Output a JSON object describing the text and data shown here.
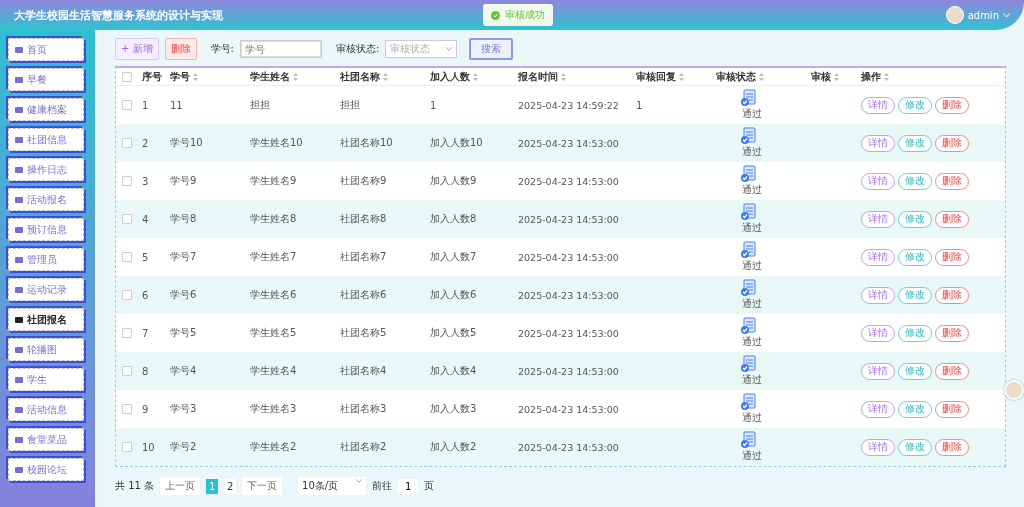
{
  "header": {
    "title": "大学生校园生活智慧服务系统的设计与实现",
    "toast": "审核成功",
    "user": "admin"
  },
  "sidebar": {
    "items": [
      {
        "label": "首页",
        "selected": false
      },
      {
        "label": "早餐",
        "selected": false
      },
      {
        "label": "健康档案",
        "selected": false
      },
      {
        "label": "社团信息",
        "selected": false
      },
      {
        "label": "操作日志",
        "selected": false
      },
      {
        "label": "活动报名",
        "selected": false
      },
      {
        "label": "预订信息",
        "selected": false
      },
      {
        "label": "管理员",
        "selected": false
      },
      {
        "label": "运动记录",
        "selected": false
      },
      {
        "label": "社团报名",
        "selected": true
      },
      {
        "label": "轮播图",
        "selected": false
      },
      {
        "label": "学生",
        "selected": false
      },
      {
        "label": "活动信息",
        "selected": false
      },
      {
        "label": "食堂菜品",
        "selected": false
      },
      {
        "label": "校园论坛",
        "selected": false
      }
    ]
  },
  "toolbar": {
    "add_button": "+ 新增",
    "delete_button": "删除",
    "student_id_label": "学号:",
    "student_id_placeholder": "学号",
    "status_label": "审核状态:",
    "status_placeholder": "审核状态",
    "search_button": "搜索"
  },
  "table": {
    "select_all_checked": false,
    "columns": [
      "序号",
      "学号",
      "学生姓名",
      "社团名称",
      "加入人数",
      "报名时间",
      "审核回复",
      "审核状态",
      "审核",
      "操作"
    ],
    "rows": [
      {
        "checked": false,
        "cells": [
          "1",
          "11",
          "担担",
          "担担",
          "1",
          "2025-04-23 14:59:22",
          "1",
          "",
          "",
          ""
        ],
        "status": "通过",
        "actions": [
          {
            "label": "详情",
            "kind": "detail"
          },
          {
            "label": "修改",
            "kind": "edit"
          },
          {
            "label": "删除",
            "kind": "delete"
          }
        ]
      },
      {
        "checked": false,
        "cells": [
          "2",
          "学号10",
          "学生姓名10",
          "社团名称10",
          "加入人数10",
          "2025-04-23 14:53:00",
          "",
          "",
          "",
          ""
        ],
        "status": "通过",
        "actions": [
          {
            "label": "详情",
            "kind": "detail"
          },
          {
            "label": "修改",
            "kind": "edit"
          },
          {
            "label": "删除",
            "kind": "delete"
          }
        ]
      },
      {
        "checked": false,
        "cells": [
          "3",
          "学号9",
          "学生姓名9",
          "社团名称9",
          "加入人数9",
          "2025-04-23 14:53:00",
          "",
          "",
          "",
          ""
        ],
        "status": "通过",
        "actions": [
          {
            "label": "详情",
            "kind": "detail"
          },
          {
            "label": "修改",
            "kind": "edit"
          },
          {
            "label": "删除",
            "kind": "delete"
          }
        ]
      },
      {
        "checked": false,
        "cells": [
          "4",
          "学号8",
          "学生姓名8",
          "社团名称8",
          "加入人数8",
          "2025-04-23 14:53:00",
          "",
          "",
          "",
          ""
        ],
        "status": "通过",
        "actions": [
          {
            "label": "详情",
            "kind": "detail"
          },
          {
            "label": "修改",
            "kind": "edit"
          },
          {
            "label": "删除",
            "kind": "delete"
          }
        ]
      },
      {
        "checked": false,
        "cells": [
          "5",
          "学号7",
          "学生姓名7",
          "社团名称7",
          "加入人数7",
          "2025-04-23 14:53:00",
          "",
          "",
          "",
          ""
        ],
        "status": "通过",
        "actions": [
          {
            "label": "详情",
            "kind": "detail"
          },
          {
            "label": "修改",
            "kind": "edit"
          },
          {
            "label": "删除",
            "kind": "delete"
          }
        ]
      },
      {
        "checked": false,
        "cells": [
          "6",
          "学号6",
          "学生姓名6",
          "社团名称6",
          "加入人数6",
          "2025-04-23 14:53:00",
          "",
          "",
          "",
          ""
        ],
        "status": "通过",
        "actions": [
          {
            "label": "详情",
            "kind": "detail"
          },
          {
            "label": "修改",
            "kind": "edit"
          },
          {
            "label": "删除",
            "kind": "delete"
          }
        ]
      },
      {
        "checked": false,
        "cells": [
          "7",
          "学号5",
          "学生姓名5",
          "社团名称5",
          "加入人数5",
          "2025-04-23 14:53:00",
          "",
          "",
          "",
          ""
        ],
        "status": "通过",
        "actions": [
          {
            "label": "详情",
            "kind": "detail"
          },
          {
            "label": "修改",
            "kind": "edit"
          },
          {
            "label": "删除",
            "kind": "delete"
          }
        ]
      },
      {
        "checked": false,
        "cells": [
          "8",
          "学号4",
          "学生姓名4",
          "社团名称4",
          "加入人数4",
          "2025-04-23 14:53:00",
          "",
          "",
          "",
          ""
        ],
        "status": "通过",
        "actions": [
          {
            "label": "详情",
            "kind": "detail"
          },
          {
            "label": "修改",
            "kind": "edit"
          },
          {
            "label": "删除",
            "kind": "delete"
          }
        ]
      },
      {
        "checked": false,
        "cells": [
          "9",
          "学号3",
          "学生姓名3",
          "社团名称3",
          "加入人数3",
          "2025-04-23 14:53:00",
          "",
          "",
          "",
          ""
        ],
        "status": "通过",
        "actions": [
          {
            "label": "详情",
            "kind": "detail"
          },
          {
            "label": "修改",
            "kind": "edit"
          },
          {
            "label": "删除",
            "kind": "delete"
          }
        ]
      },
      {
        "checked": false,
        "cells": [
          "10",
          "学号2",
          "学生姓名2",
          "社团名称2",
          "加入人数2",
          "2025-04-23 14:53:00",
          "",
          "",
          "",
          ""
        ],
        "status": "通过",
        "actions": [
          {
            "label": "详情",
            "kind": "detail"
          },
          {
            "label": "修改",
            "kind": "edit"
          },
          {
            "label": "删除",
            "kind": "delete"
          }
        ]
      }
    ]
  },
  "pagination": {
    "total": "共 11 条",
    "prev": "上一页",
    "pages": [
      {
        "label": "1",
        "selected": true
      },
      {
        "label": "2",
        "selected": false
      }
    ],
    "next": "下一页",
    "page_size": "10条/页",
    "goto_label": "前往",
    "goto_value": "1",
    "goto_suffix": "页"
  }
}
